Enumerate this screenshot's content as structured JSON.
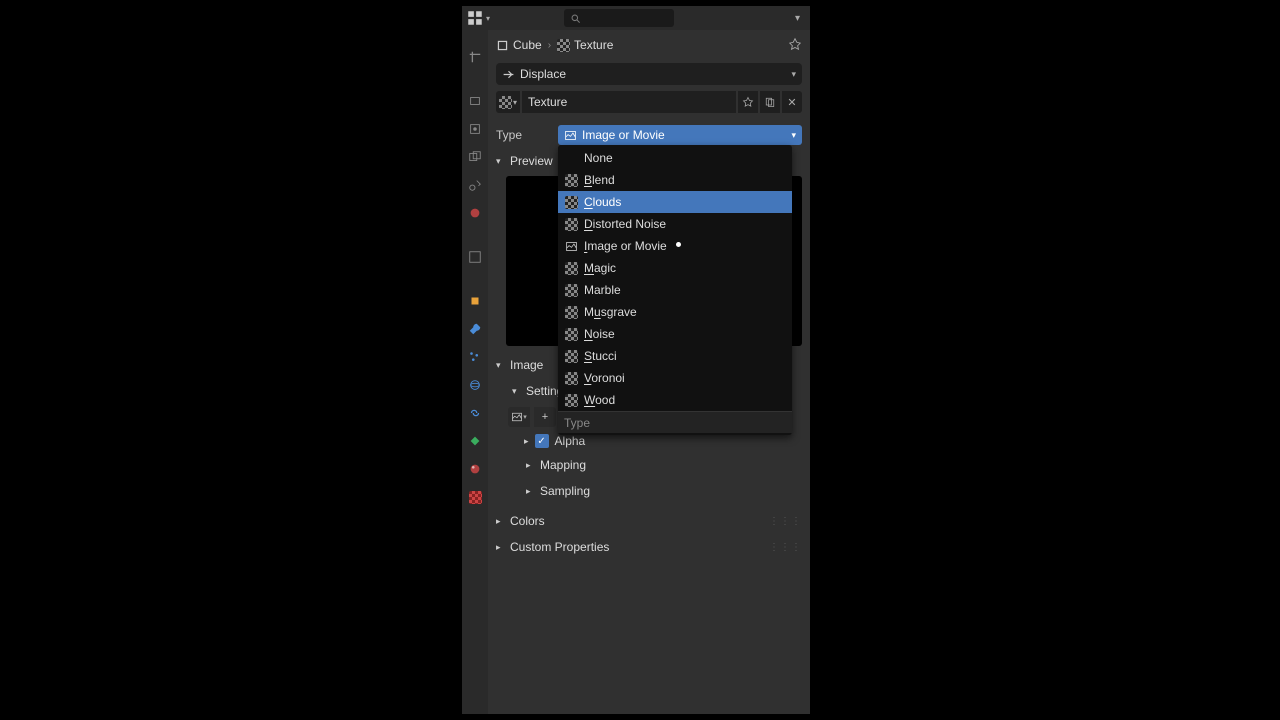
{
  "breadcrumb": {
    "object": "Cube",
    "texture": "Texture"
  },
  "modifier_select": "Displace",
  "texture_name": "Texture",
  "type_label": "Type",
  "type_value": "Image or Movie",
  "dropdown": {
    "items": [
      {
        "label": "None",
        "icon": "none"
      },
      {
        "label": "Blend",
        "icon": "checker",
        "uline": "B"
      },
      {
        "label": "Clouds",
        "icon": "checker",
        "uline": "C",
        "hover": true
      },
      {
        "label": "Distorted Noise",
        "icon": "checker",
        "uline": "D"
      },
      {
        "label": "Image or Movie",
        "icon": "image",
        "uline": "I"
      },
      {
        "label": "Magic",
        "icon": "checker",
        "uline": "M"
      },
      {
        "label": "Marble",
        "icon": "checker"
      },
      {
        "label": "Musgrave",
        "icon": "checker",
        "uline": "u"
      },
      {
        "label": "Noise",
        "icon": "checker",
        "uline": "N"
      },
      {
        "label": "Stucci",
        "icon": "checker",
        "uline": "S"
      },
      {
        "label": "Voronoi",
        "icon": "checker",
        "uline": "V"
      },
      {
        "label": "Wood",
        "icon": "checker",
        "uline": "W"
      }
    ],
    "footer": "Type"
  },
  "sections": {
    "preview": "Preview",
    "image": "Image",
    "settings": "Settings",
    "alpha": "Alpha",
    "mapping": "Mapping",
    "sampling": "Sampling",
    "colors": "Colors",
    "custom_properties": "Custom Properties"
  },
  "tab_colors": {
    "render": "#888",
    "output": "#888",
    "view": "#888",
    "scene": "#888",
    "world": "#b04040",
    "object": "#e8a23a",
    "modifier": "#4a8cd8",
    "particle": "#4a8cd8",
    "physics": "#4a8cd8",
    "constraint": "#4a8cd8",
    "material": "#b04040",
    "texture_active": "#c44444"
  }
}
